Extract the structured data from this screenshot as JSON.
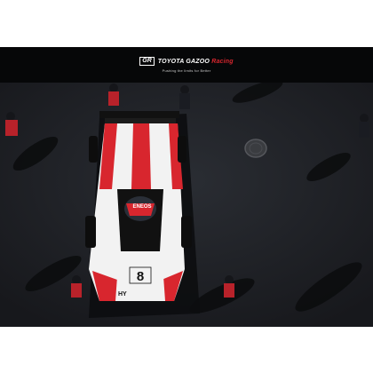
{
  "banner": {
    "badge": "GR",
    "brand_main": "TOYOTA GAZOO ",
    "brand_accent": "Racing",
    "tagline": "Pushing the limits for Better"
  },
  "car": {
    "number": "8",
    "nose_label": "HY",
    "sponsor": "ENEOS"
  },
  "colors": {
    "banner_bg": "#060708",
    "asphalt": "#202227",
    "livery_red": "#d8262e",
    "livery_white": "#f2f2f2",
    "livery_black": "#111111"
  }
}
